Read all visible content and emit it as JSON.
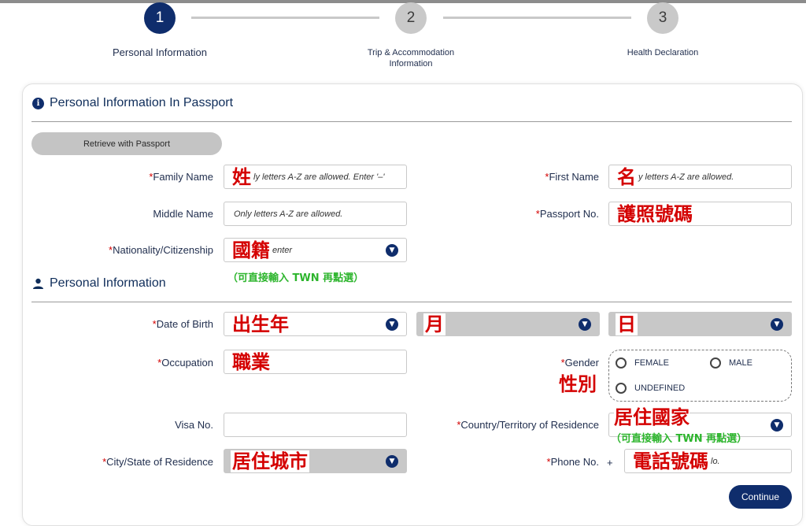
{
  "stepper": {
    "steps": [
      {
        "number": "1",
        "label": "Personal Information",
        "active": true
      },
      {
        "number": "2",
        "label_line1": "Trip & Accommodation",
        "label_line2": "Information",
        "active": false
      },
      {
        "number": "3",
        "label": "Health Declaration",
        "active": false
      }
    ]
  },
  "section_passport": {
    "title": "Personal Information In Passport",
    "retrieve_button": "Retrieve with Passport"
  },
  "section_personal": {
    "title": "Personal Information"
  },
  "fields": {
    "family_name": {
      "label": "Family Name",
      "placeholder": "ly letters A-Z are allowed. Enter '–'",
      "annotation": "姓"
    },
    "first_name": {
      "label": "First Name",
      "placeholder": "y letters A-Z are allowed.",
      "annotation": "名"
    },
    "middle_name": {
      "label": "Middle Name",
      "placeholder": "Only letters A-Z are allowed."
    },
    "passport_no": {
      "label": "Passport No.",
      "annotation": "護照號碼"
    },
    "nationality": {
      "label": "Nationality/Citizenship",
      "placeholder": "enter",
      "annotation": "國籍",
      "note": "（可直接輸入 TWN 再點選）"
    },
    "dob": {
      "label": "Date of Birth",
      "year_annotation": "出生年",
      "month_annotation": "月",
      "day_annotation": "日"
    },
    "occupation": {
      "label": "Occupation",
      "annotation": "職業"
    },
    "gender": {
      "label": "Gender",
      "annotation": "性別",
      "options": [
        "FEMALE",
        "MALE",
        "UNDEFINED"
      ]
    },
    "visa_no": {
      "label": "Visa No."
    },
    "country_residence": {
      "label": "Country/Territory of Residence",
      "annotation": "居住國家",
      "note": "（可直接輸入 TWN 再點選）"
    },
    "city_residence": {
      "label": "City/State of Residence",
      "annotation": "居住城市"
    },
    "phone_no": {
      "label": "Phone No.",
      "prefix": "+",
      "placeholder": "lo.",
      "annotation": "電話號碼"
    }
  },
  "required_mark": "*",
  "continue_button": "Continue",
  "colors": {
    "primary": "#0f2d6c",
    "annotation_red": "#d40000",
    "annotation_green": "#2db52d",
    "inactive_gray": "#c9c9c9"
  }
}
